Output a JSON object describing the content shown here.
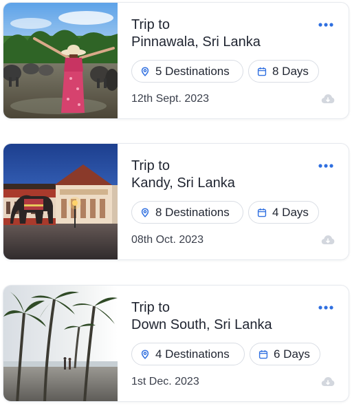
{
  "colors": {
    "accent": "#2f6fe0",
    "border": "#e6e9ee",
    "chip_border": "#d9dde4",
    "cloud_icon": "#d3d7de"
  },
  "trips": [
    {
      "title_line1": "Trip to",
      "title_line2": "Pinnawala, Sri Lanka",
      "destinations": "5 Destinations",
      "days": "8 Days",
      "date": "12th Sept. 2023",
      "image": "woman-with-elephants-photo"
    },
    {
      "title_line1": "Trip to",
      "title_line2": "Kandy, Sri Lanka",
      "destinations": "8 Destinations",
      "days": "4 Days",
      "date": "08th Oct. 2023",
      "image": "temple-of-tooth-photo"
    },
    {
      "title_line1": "Trip to",
      "title_line2": "Down South, Sri Lanka",
      "destinations": "4 Destinations",
      "days": "6 Days",
      "date": "1st Dec. 2023",
      "image": "palm-beach-photo"
    }
  ],
  "icons": {
    "more": "more-horizontal-icon",
    "location": "location-pin-icon",
    "calendar": "calendar-icon",
    "download": "cloud-download-icon"
  }
}
